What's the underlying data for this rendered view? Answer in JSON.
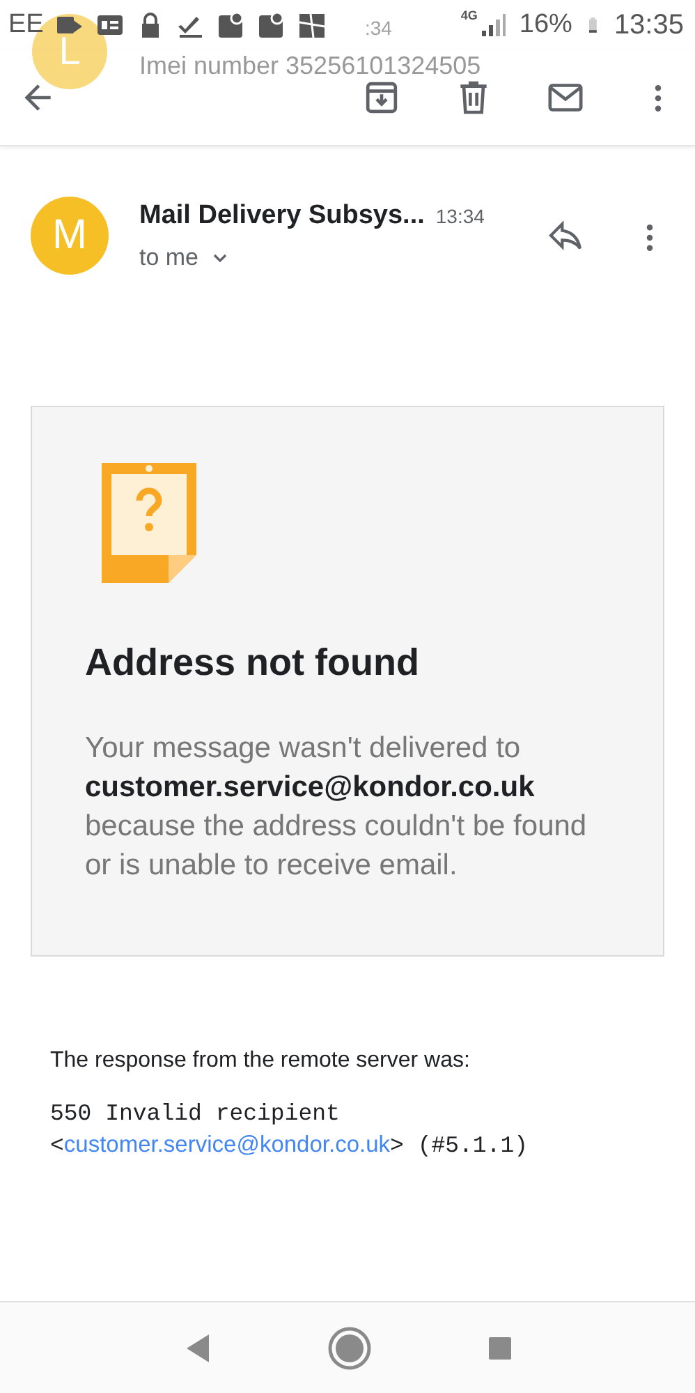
{
  "status_bar": {
    "carrier": "EE",
    "network": "4G",
    "battery": "16%",
    "time": "13:35"
  },
  "notification_ghost": {
    "avatar_letter": "L",
    "time": ":34",
    "preview": "Imei number 35256101324505"
  },
  "message": {
    "avatar_letter": "M",
    "sender": "Mail Delivery Subsys...",
    "time": "13:34",
    "recipient": "to me"
  },
  "card": {
    "title": "Address not found",
    "body": "Your message wasn't delivered to **customer.service@kondor.co.uk** because the address couldn't be found or is unable to receive email."
  },
  "response": {
    "intro": "The response from the remote server was:",
    "line_1": "550 Invalid recipient",
    "line_2_before": "<",
    "line_2_link": "customer.service@kondor.co.uk",
    "line_2_after": "> (#5.1.1)"
  }
}
